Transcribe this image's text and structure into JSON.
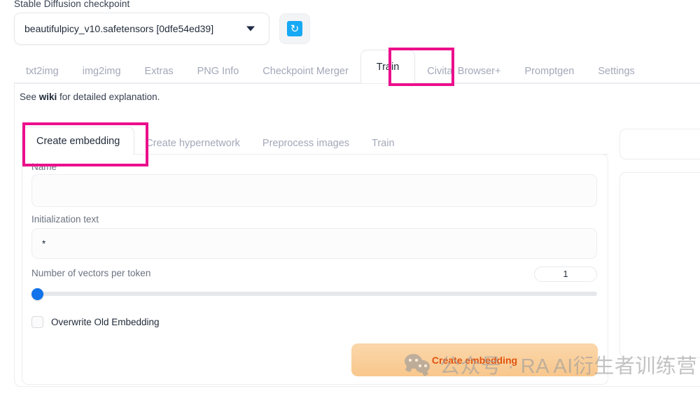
{
  "checkpoint": {
    "label": "Stable Diffusion checkpoint",
    "value": "beautifulpicy_v10.safetensors [0dfe54ed39]",
    "refresh_icon": "refresh-icon",
    "caret_icon": "chevron-down-icon"
  },
  "top_tabs": [
    {
      "label": "txt2img",
      "active": false
    },
    {
      "label": "img2img",
      "active": false
    },
    {
      "label": "Extras",
      "active": false
    },
    {
      "label": "PNG Info",
      "active": false
    },
    {
      "label": "Checkpoint Merger",
      "active": false
    },
    {
      "label": "Train",
      "active": true
    },
    {
      "label": "Civitai Browser+",
      "active": false
    },
    {
      "label": "Promptgen",
      "active": false
    },
    {
      "label": "Settings",
      "active": false
    }
  ],
  "wiki_notice": {
    "prefix": "See ",
    "link": "wiki",
    "suffix": " for detailed explanation."
  },
  "inner_tabs": [
    {
      "label": "Create embedding",
      "active": true
    },
    {
      "label": "Create hypernetwork",
      "active": false
    },
    {
      "label": "Preprocess images",
      "active": false
    },
    {
      "label": "Train",
      "active": false
    }
  ],
  "form": {
    "name": {
      "label": "Name",
      "value": "",
      "placeholder": ""
    },
    "initialization_text": {
      "label": "Initialization text",
      "value": "*",
      "placeholder": ""
    },
    "vectors_per_token": {
      "label": "Number of vectors per token",
      "value": "1",
      "min": 1,
      "max": 75,
      "percent": 0
    },
    "overwrite": {
      "label": "Overwrite Old Embedding",
      "checked": false
    }
  },
  "primary_button": {
    "label": "Create embedding"
  },
  "watermark": {
    "text": "公众号 · RA AI衍生者训练营",
    "logo": "wechat-logo"
  },
  "annotations": [
    {
      "name": "annotation-train-tab",
      "color": "#ec0f8c"
    },
    {
      "name": "annotation-create-embedding-tab",
      "color": "#ec0f8c"
    }
  ]
}
